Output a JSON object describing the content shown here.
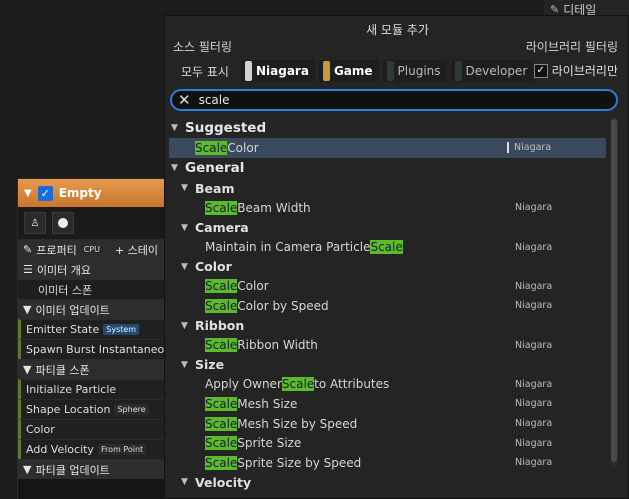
{
  "details_tab": {
    "icon": "pencil-icon",
    "label": "디테일"
  },
  "emitter_node": {
    "name": "Empty",
    "rows": [
      {
        "label": "프로퍼티",
        "tag": "CPU",
        "extra": "+ 스테이",
        "kind": "section"
      },
      {
        "label": "이미터 개요",
        "kind": "section"
      },
      {
        "label": "이미터 스폰",
        "kind": "sub"
      },
      {
        "label": "이미터 업데이트",
        "kind": "section"
      },
      {
        "label": "Emitter State",
        "tag": "System",
        "kind": "param"
      },
      {
        "label": "Spawn Burst Instantaneous",
        "kind": "param"
      },
      {
        "label": "파티클 스폰",
        "kind": "section"
      },
      {
        "label": "Initialize Particle",
        "kind": "param"
      },
      {
        "label": "Shape Location",
        "tag": "Sphere",
        "kind": "param"
      },
      {
        "label": "Color",
        "kind": "param"
      },
      {
        "label": "Add Velocity",
        "tag": "From Point",
        "kind": "param"
      },
      {
        "label": "파티클 업데이트",
        "kind": "section"
      }
    ]
  },
  "popup": {
    "title": "새 모듈 추가",
    "source_filter_label": "소스 필터링",
    "library_filter_label": "라이브러리 필터링",
    "filters": [
      {
        "label": "모두 표시",
        "color": "",
        "state": "plain"
      },
      {
        "label": "Niagara",
        "color": "#d0d0d0",
        "state": "on"
      },
      {
        "label": "Game",
        "color": "#c89a3c",
        "state": "on"
      },
      {
        "label": "Plugins",
        "color": "#2e3a38",
        "state": "off"
      },
      {
        "label": "Developer",
        "color": "#2e3a38",
        "state": "off"
      }
    ],
    "library_only_label": "라이브러리만",
    "library_only_checked": true,
    "search_value": "scale",
    "source_name": "Niagara",
    "list": [
      {
        "kind": "cat",
        "label": "Suggested"
      },
      {
        "kind": "sugg",
        "pre": "",
        "hl": "Scale",
        "post": " Color",
        "selected": true
      },
      {
        "kind": "cat",
        "label": "General"
      },
      {
        "kind": "sub",
        "label": "Beam"
      },
      {
        "kind": "item",
        "pre": "",
        "hl": "Scale",
        "post": " Beam Width"
      },
      {
        "kind": "sub",
        "label": "Camera"
      },
      {
        "kind": "item",
        "pre": "Maintain in Camera Particle ",
        "hl": "Scale",
        "post": ""
      },
      {
        "kind": "sub",
        "label": "Color"
      },
      {
        "kind": "item",
        "pre": "",
        "hl": "Scale",
        "post": " Color"
      },
      {
        "kind": "item",
        "pre": "",
        "hl": "Scale",
        "post": " Color by Speed"
      },
      {
        "kind": "sub",
        "label": "Ribbon"
      },
      {
        "kind": "item",
        "pre": "",
        "hl": "Scale",
        "post": " Ribbon Width"
      },
      {
        "kind": "sub",
        "label": "Size"
      },
      {
        "kind": "item",
        "pre": "Apply Owner ",
        "hl": "Scale",
        "post": " to Attributes"
      },
      {
        "kind": "item",
        "pre": "",
        "hl": "Scale",
        "post": " Mesh Size"
      },
      {
        "kind": "item",
        "pre": "",
        "hl": "Scale",
        "post": " Mesh Size by Speed"
      },
      {
        "kind": "item",
        "pre": "",
        "hl": "Scale",
        "post": " Sprite Size"
      },
      {
        "kind": "item",
        "pre": "",
        "hl": "Scale",
        "post": " Sprite Size by Speed"
      },
      {
        "kind": "sub",
        "label": "Velocity"
      }
    ]
  }
}
